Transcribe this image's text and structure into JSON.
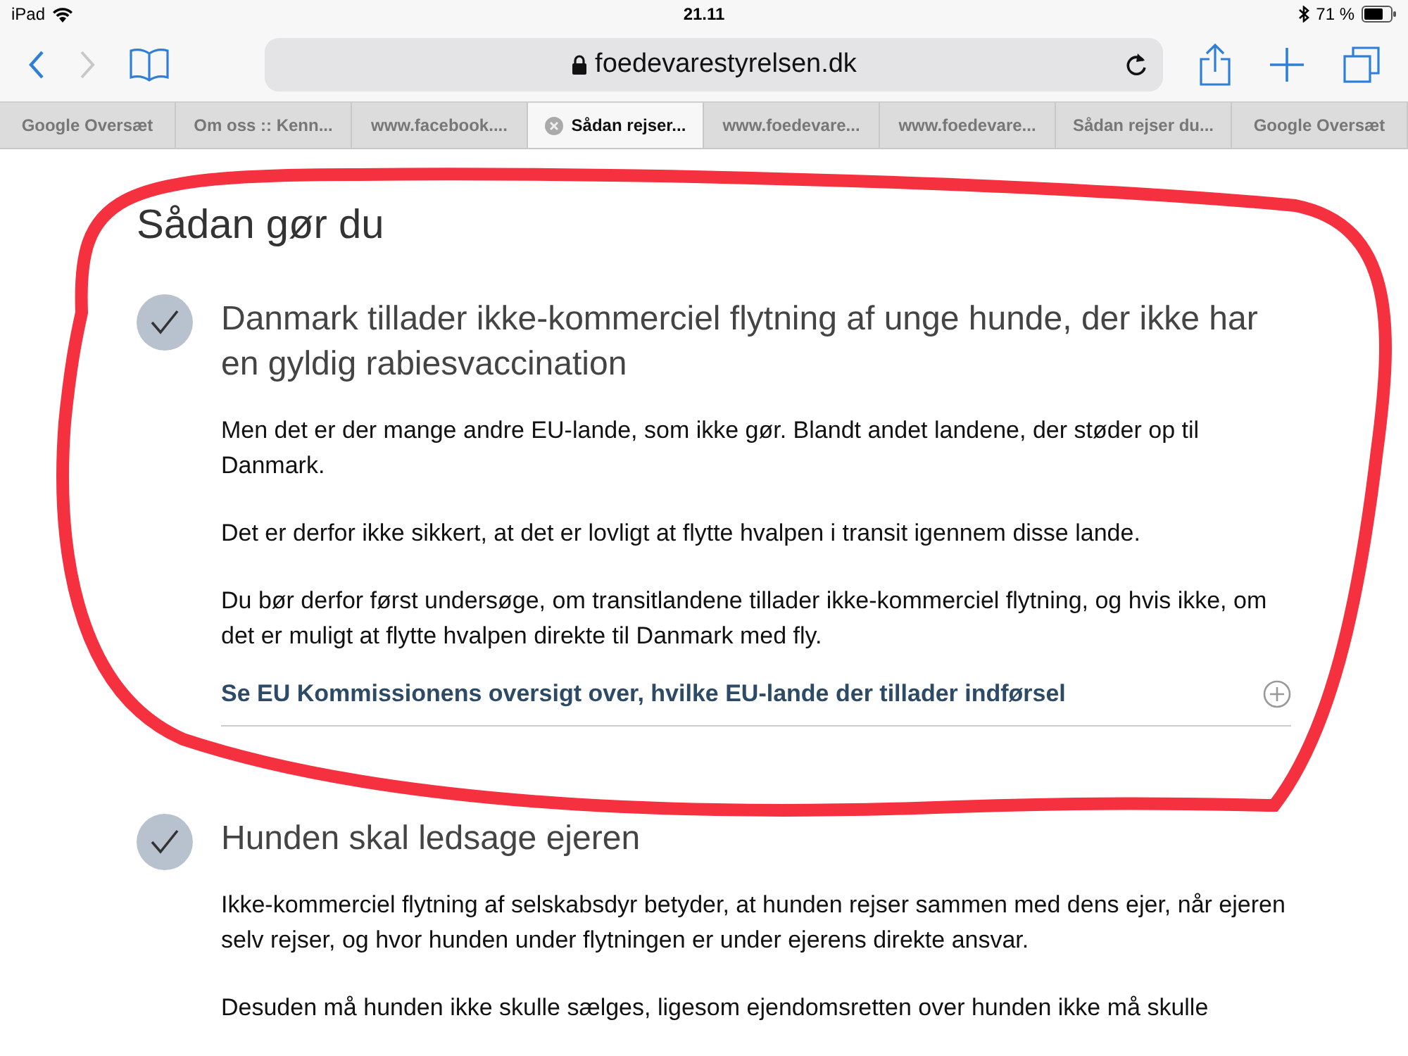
{
  "status_bar": {
    "device": "iPad",
    "time": "21.11",
    "battery": "71 %"
  },
  "toolbar": {
    "url": "foedevarestyrelsen.dk"
  },
  "tabs": [
    {
      "label": "Google Oversæt",
      "selected": false
    },
    {
      "label": "Om oss :: Kenn...",
      "selected": false
    },
    {
      "label": "www.facebook....",
      "selected": false
    },
    {
      "label": "Sådan rejser...",
      "selected": true
    },
    {
      "label": "www.foedevare...",
      "selected": false
    },
    {
      "label": "www.foedevare...",
      "selected": false
    },
    {
      "label": "Sådan rejser du...",
      "selected": false
    },
    {
      "label": "Google Oversæt",
      "selected": false
    }
  ],
  "page": {
    "heading": "Sådan gør du",
    "sections": [
      {
        "title": "Danmark tillader ikke-kommerciel flytning af unge hunde, der ikke har en gyldig rabiesvaccination",
        "checked": true,
        "paragraphs": [
          "Men det er der mange andre EU-lande, som ikke gør. Blandt andet landene, der støder op til Danmark.",
          "Det er derfor ikke sikkert, at det er lovligt at flytte hvalpen i transit igennem disse lande.",
          "Du bør derfor først undersøge, om transitlandene tillader ikke-kommerciel flytning, og hvis ikke, om det er muligt at flytte hvalpen direkte til Danmark med fly."
        ],
        "link": "Se EU Kommissionens oversigt over, hvilke EU-lande der tillader indførsel"
      },
      {
        "title": "Hunden skal ledsage ejeren",
        "checked": true,
        "paragraphs": [
          "Ikke-kommerciel flytning af selskabsdyr betyder, at hunden rejser sammen med dens ejer, når ejeren selv rejser, og hvor hunden under flytningen er under ejerens direkte ansvar.",
          "Desuden må hunden ikke skulle sælges, ligesom ejendomsretten over hunden ikke må skulle"
        ]
      }
    ]
  }
}
